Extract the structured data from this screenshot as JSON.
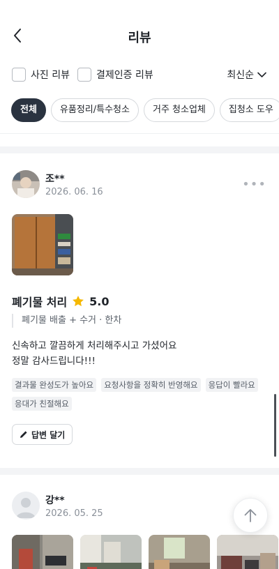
{
  "header": {
    "title": "리뷰",
    "back_icon": "chevron-left-icon"
  },
  "filters": {
    "photo_review": "사진 리뷰",
    "verified_review": "결제인증 리뷰",
    "sort": "최신순"
  },
  "categories": [
    "전체",
    "유품정리/특수청소",
    "거주 청소업체",
    "집청소 도우"
  ],
  "reviews": [
    {
      "author": "조**",
      "date": "2026. 06. 16",
      "service": "폐기물 처리",
      "rating": "5.0",
      "detail": "폐기물 배출 + 수거 · 한차",
      "text": "신속하고 깔끔하게 처리해주시고 가셨어요\n정말 감사드립니다!!!",
      "tags": [
        "결과물 완성도가 높아요",
        "요청사항을 정확히 반영해요",
        "응답이 빨라요",
        "응대가 친절해요"
      ],
      "reply_label": "답변 달기"
    },
    {
      "author": "강**",
      "date": "2026. 05. 25"
    }
  ],
  "colors": {
    "active_chip": "#2a3340",
    "star": "#f5b800",
    "text": "#1f2329",
    "muted": "#8a9099"
  }
}
